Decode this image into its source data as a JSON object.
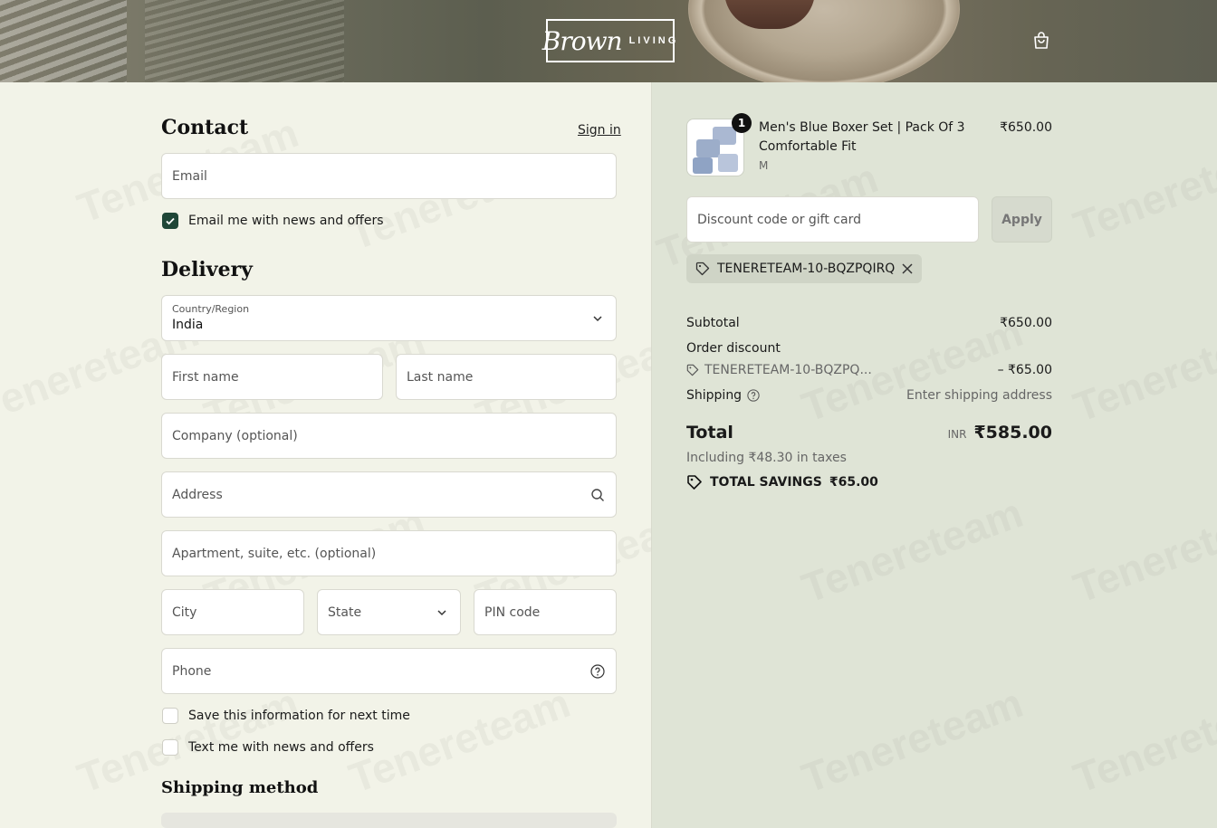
{
  "header": {
    "logo_script": "Brown",
    "logo_caps": "LIVING"
  },
  "watermark_text": "Tenereteam",
  "contact": {
    "title": "Contact",
    "sign_in": "Sign in",
    "email_placeholder": "Email",
    "news_checkbox_label": "Email me with news and offers",
    "news_checked": true
  },
  "delivery": {
    "title": "Delivery",
    "country_label": "Country/Region",
    "country_value": "India",
    "first_name": "First name",
    "last_name": "Last name",
    "company": "Company (optional)",
    "address": "Address",
    "apartment": "Apartment, suite, etc. (optional)",
    "city": "City",
    "state": "State",
    "pin": "PIN code",
    "phone": "Phone",
    "save_info_label": "Save this information for next time",
    "text_news_label": "Text me with news and offers"
  },
  "shipping_method": {
    "title": "Shipping method"
  },
  "order": {
    "product": {
      "title": "Men's Blue Boxer Set | Pack Of 3 Comfortable Fit",
      "variant": "M",
      "quantity": "1",
      "price": "₹650.00"
    },
    "discount_placeholder": "Discount code or gift card",
    "apply_label": "Apply",
    "applied_code": "TENERETEAM-10-BQZPQIRQ",
    "subtotal_label": "Subtotal",
    "subtotal_value": "₹650.00",
    "order_discount_label": "Order discount",
    "discount_code_short": "TENERETEAM-10-BQZPQ...",
    "discount_value": "– ₹65.00",
    "shipping_label": "Shipping",
    "shipping_value": "Enter shipping address",
    "total_label": "Total",
    "currency": "INR",
    "total_value": "₹585.00",
    "taxes_note": "Including ₹48.30 in taxes",
    "savings_label": "TOTAL SAVINGS",
    "savings_value": "₹65.00"
  }
}
